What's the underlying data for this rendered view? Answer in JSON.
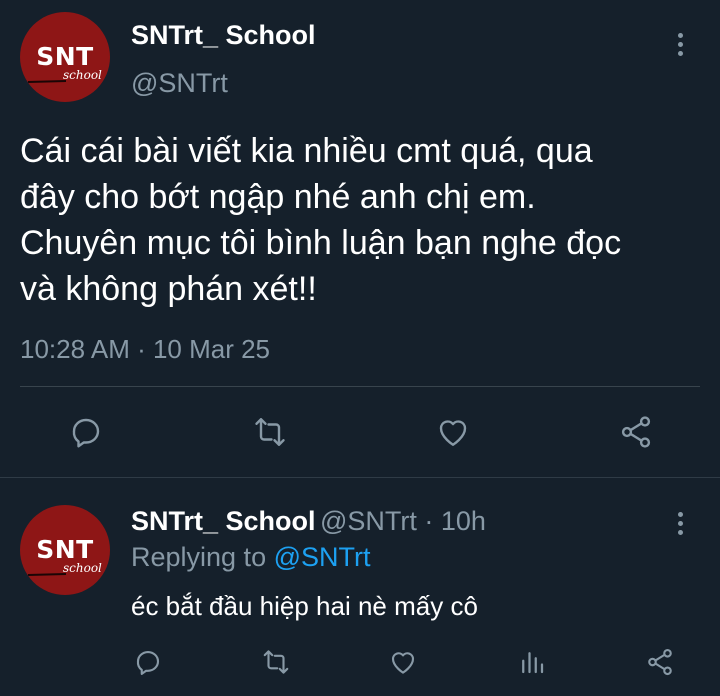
{
  "main_tweet": {
    "avatar": {
      "initials": "SNT",
      "sub": "school"
    },
    "display_name": "SNTrt_ School",
    "handle": "@SNTrt",
    "text_lines": [
      "Cái cái bài viết kia nhiều cmt quá, qua",
      "đây cho bớt ngập nhé anh chị em.",
      "Chuyên mục tôi bình luận bạn nghe đọc",
      "và không phán xét!!"
    ],
    "timestamp": "10:28 AM · 10 Mar 25",
    "actions": [
      "reply-icon",
      "retweet-icon",
      "like-icon",
      "share-icon"
    ]
  },
  "reply_tweet": {
    "avatar": {
      "initials": "SNT",
      "sub": "school"
    },
    "display_name": "SNTrt_ School",
    "meta": "@SNTrt · 10h",
    "replying_prefix": "Replying to ",
    "replying_to": "@SNTrt",
    "text": "éc bắt đầu hiệp hai nè mấy cô",
    "actions": [
      "reply-icon",
      "retweet-icon",
      "like-icon",
      "analytics-icon",
      "share-icon"
    ]
  },
  "colors": {
    "background": "#15202b",
    "muted": "#8899a6",
    "link": "#1da1f2",
    "divider": "#38444d",
    "avatar_bg": "#8e1616"
  }
}
